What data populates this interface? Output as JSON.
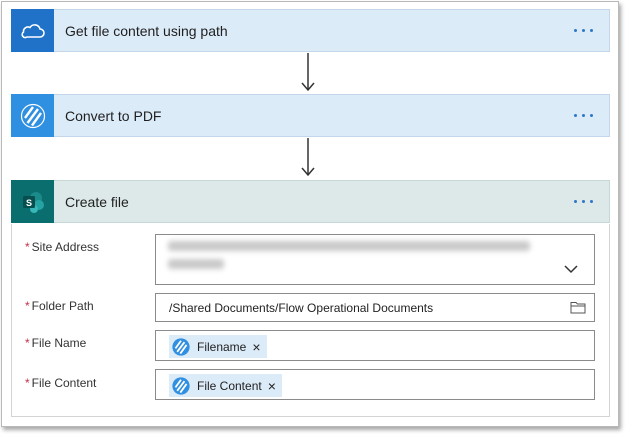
{
  "steps": [
    {
      "title": "Get file content using path",
      "icon": "onedrive-icon"
    },
    {
      "title": "Convert to PDF",
      "icon": "pdf-converter-icon"
    },
    {
      "title": "Create file",
      "icon": "sharepoint-icon"
    }
  ],
  "more_label": "...",
  "create_file": {
    "site_address": {
      "label": "Site Address",
      "required": "*"
    },
    "folder_path": {
      "label": "Folder Path",
      "required": "*",
      "value": "/Shared Documents/Flow Operational Documents"
    },
    "file_name": {
      "label": "File Name",
      "required": "*",
      "token": "Filename",
      "remove": "×"
    },
    "file_content": {
      "label": "File Content",
      "required": "*",
      "token": "File Content",
      "remove": "×"
    }
  },
  "colors": {
    "header_blue": "#dcebf8",
    "header_teal": "#dde9e9",
    "onedrive": "#1f72c8",
    "pdf": "#2f8fe0",
    "sharepoint": "#0b6e6e",
    "accent": "#2e76c7",
    "required": "#c4314b"
  }
}
